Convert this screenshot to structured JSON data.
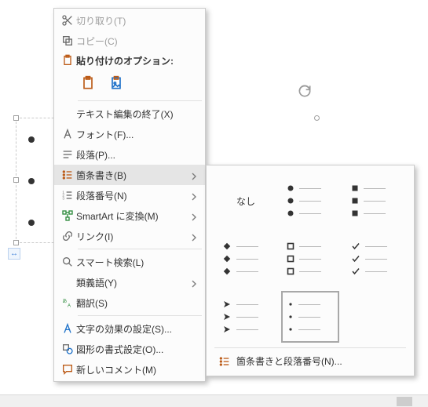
{
  "menu": {
    "cut": "切り取り(T)",
    "copy": "コピー(C)",
    "paste_header": "貼り付けのオプション:",
    "paste_options": [
      "元の書式を保持",
      "図"
    ],
    "exit_text_edit": "テキスト編集の終了(X)",
    "font": "フォント(F)...",
    "paragraph": "段落(P)...",
    "bullets": "箇条書き(B)",
    "numbering": "段落番号(N)",
    "smartart": "SmartArt に変換(M)",
    "link": "リンク(I)",
    "smart_lookup": "スマート検索(L)",
    "thesaurus": "類義語(Y)",
    "translate": "翻訳(S)",
    "text_effects": "文字の効果の設定(S)...",
    "format_shape": "図形の書式設定(O)...",
    "new_comment": "新しいコメント(M)"
  },
  "gallery": {
    "none_label": "なし",
    "more": "箇条書きと段落番号(N)...",
    "cells": [
      {
        "type": "none"
      },
      {
        "type": "disc"
      },
      {
        "type": "square"
      },
      {
        "type": "diamond"
      },
      {
        "type": "hollow-square"
      },
      {
        "type": "check"
      },
      {
        "type": "arrow"
      },
      {
        "type": "dot",
        "selected": true
      }
    ]
  },
  "ruler_mark": "↔"
}
